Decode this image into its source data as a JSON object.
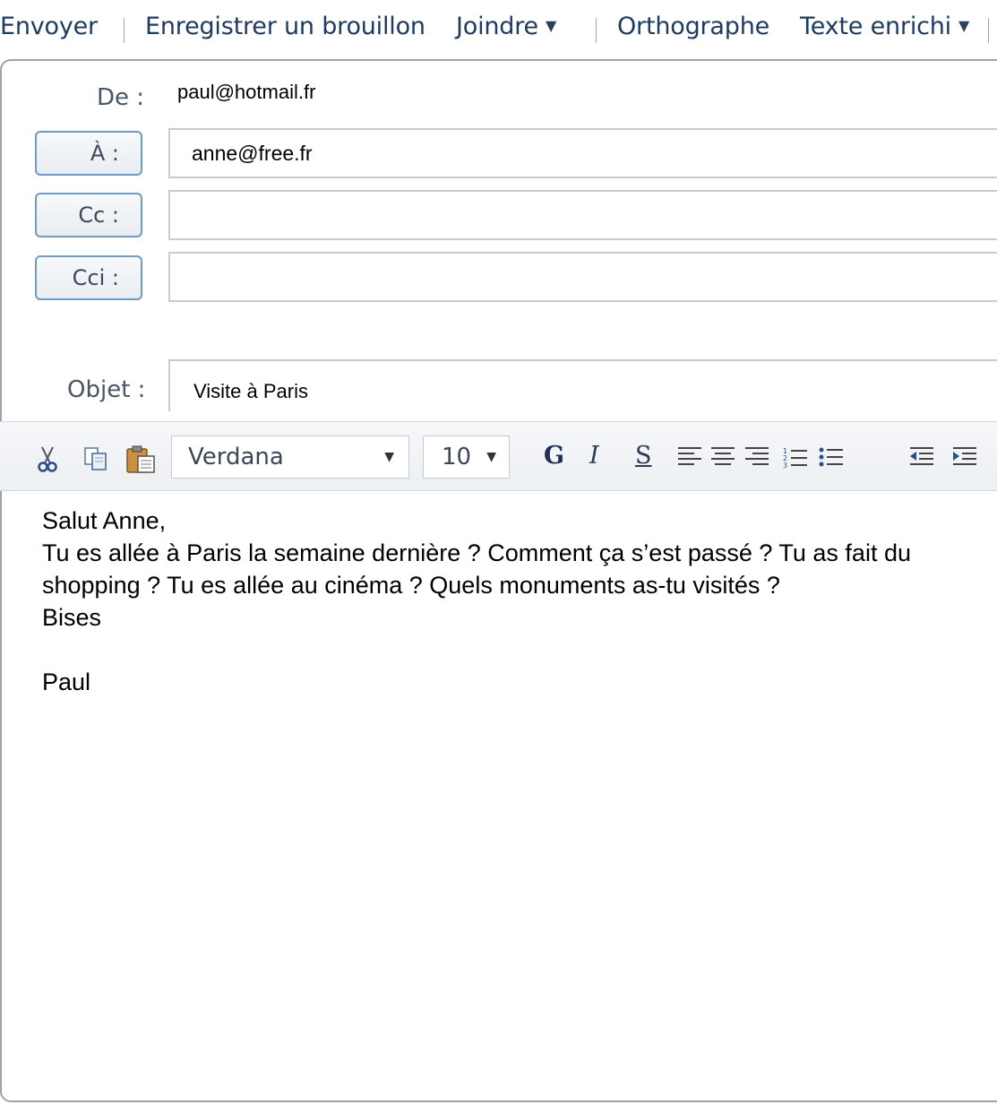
{
  "toolbar": {
    "send": "Envoyer",
    "save_draft": "Enregistrer un brouillon",
    "attach": "Joindre",
    "spelling": "Orthographe",
    "rich_text": "Texte enrichi"
  },
  "header": {
    "from_label": "De :",
    "from_value": "paul@hotmail.fr",
    "to_label": "À :",
    "to_value": "anne@free.fr",
    "cc_label": "Cc :",
    "cc_value": "",
    "bcc_label": "Cci :",
    "bcc_value": "",
    "subject_label": "Objet :",
    "subject_value": "Visite à Paris"
  },
  "format": {
    "font": "Verdana",
    "size": "10",
    "bold": "G",
    "italic": "I",
    "underline": "S"
  },
  "message": {
    "lines": [
      "Salut Anne,",
      "Tu es allée à Paris  la semaine dernière ? Comment ça s’est passé ? Tu as fait du shopping ? Tu es allée au cinéma ? Quels monuments as-tu visités ?",
      "Bises",
      "",
      "Paul"
    ]
  },
  "colors": {
    "toolbar_text": "#1f3a5f",
    "button_border": "#6f9bc7",
    "field_border": "#c7ccd2"
  }
}
